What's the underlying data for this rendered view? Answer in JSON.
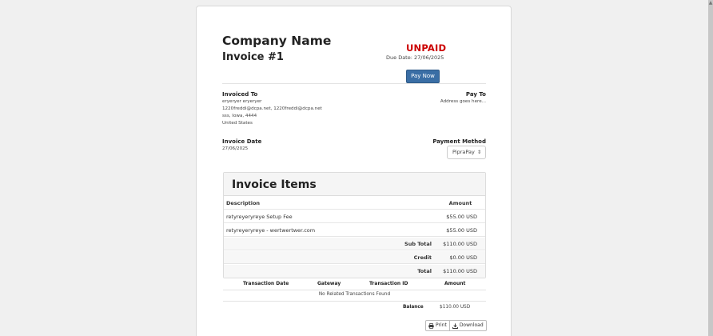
{
  "header": {
    "company_name": "Company Name",
    "invoice_number": "Invoice #1",
    "status": "UNPAID",
    "due_date": "Due Date: 27/06/2025",
    "pay_now_label": "Pay Now"
  },
  "invoiced_to": {
    "label": "Invoiced To",
    "name": "eryeryer eryeryer",
    "emails": "1220freddi@dcpa.net, 1220freddi@dcpa.net",
    "address": "sss, Iowa, 4444",
    "country": "United States"
  },
  "pay_to": {
    "label": "Pay To",
    "address": "Address goes here..."
  },
  "invoice_date": {
    "label": "Invoice Date",
    "value": "27/06/2025"
  },
  "payment_method": {
    "label": "Payment Method",
    "selected": "PipraPay"
  },
  "items": {
    "title": "Invoice Items",
    "col_description": "Description",
    "col_amount": "Amount",
    "rows": [
      {
        "description": "retyreyeryreye Setup Fee",
        "amount": "$55.00 USD"
      },
      {
        "description": "retyreyeryreye - wertwertwer.com",
        "amount": "$55.00 USD"
      }
    ],
    "summary": [
      {
        "label": "Sub Total",
        "value": "$110.00 USD"
      },
      {
        "label": "Credit",
        "value": "$0.00 USD"
      },
      {
        "label": "Total",
        "value": "$110.00 USD"
      }
    ]
  },
  "transactions": {
    "col_date": "Transaction Date",
    "col_gateway": "Gateway",
    "col_id": "Transaction ID",
    "col_amount": "Amount",
    "empty_text": "No Related Transactions Found",
    "balance_label": "Balance",
    "balance_value": "$110.00 USD"
  },
  "actions": {
    "print_label": "Print",
    "download_label": "Download",
    "print_icon": "printer-icon",
    "download_icon": "download-icon"
  },
  "colors": {
    "unpaid": "#cc0000",
    "pay_button": "#3a6ea5"
  }
}
